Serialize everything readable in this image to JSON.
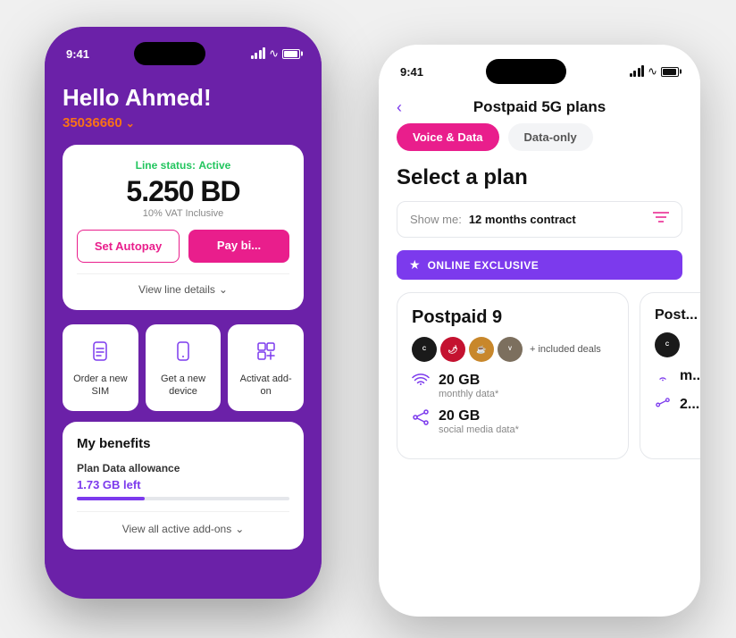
{
  "phone1": {
    "statusBar": {
      "time": "9:41",
      "iconColor": "white"
    },
    "greeting": "Hello Ahmed!",
    "phoneNumber": "35036660",
    "lineStatus": {
      "label": "Line status:",
      "status": "Active"
    },
    "balance": "5.250 BD",
    "vatText": "10% VAT Inclusive",
    "buttons": {
      "autopay": "Set Autopay",
      "paybill": "Pay bi..."
    },
    "viewLineDetails": "View line details",
    "quickActions": [
      {
        "id": "order-sim",
        "label": "Order a new SIM",
        "icon": "sim-icon"
      },
      {
        "id": "get-device",
        "label": "Get a new device",
        "icon": "phone-icon"
      },
      {
        "id": "activate-addon",
        "label": "Activat add-on",
        "icon": "addon-icon"
      }
    ],
    "myBenefits": {
      "title": "My benefits",
      "planData": {
        "label": "Plan Data allowance",
        "left": "1.73 GB left"
      },
      "viewAddons": "View all active add-ons"
    }
  },
  "phone2": {
    "statusBar": {
      "time": "9:41",
      "iconColor": "#111"
    },
    "header": {
      "back": "‹",
      "title": "Postpaid 5G plans"
    },
    "tabs": [
      {
        "id": "voice-data",
        "label": "Voice & Data",
        "active": true
      },
      {
        "id": "data-only",
        "label": "Data-only",
        "active": false
      }
    ],
    "selectPlan": {
      "title": "Select a plan",
      "showMe": {
        "label": "Show me:",
        "value": "12 months contract"
      }
    },
    "onlineExclusive": "ONLINE EXCLUSIVE",
    "plans": [
      {
        "id": "postpaid9",
        "name": "Postpaid 9",
        "deals": [
          {
            "name": "Cinepolis",
            "color": "#1a1a1a",
            "textColor": "white"
          },
          {
            "name": "Chilis",
            "color": "#c41230",
            "textColor": "white"
          },
          {
            "name": "Coffee",
            "color": "#c8872b",
            "textColor": "white"
          },
          {
            "name": "Vapiano",
            "color": "#7c6f5e",
            "textColor": "white"
          }
        ],
        "includedDeals": "+ included deals",
        "features": [
          {
            "gb": "20 GB",
            "label": "monthly data*",
            "icon": "wifi-icon"
          },
          {
            "gb": "20 GB",
            "label": "social media data*",
            "icon": "share-icon"
          }
        ]
      },
      {
        "id": "postpaid-partial",
        "name": "Post...",
        "deals": [
          {
            "name": "Cinepolis",
            "color": "#1a1a1a",
            "textColor": "white"
          }
        ],
        "features": [
          {
            "gb": "m...",
            "label": "",
            "icon": "wifi-icon"
          },
          {
            "gb": "2...",
            "label": "",
            "icon": "share-icon"
          }
        ]
      }
    ]
  }
}
